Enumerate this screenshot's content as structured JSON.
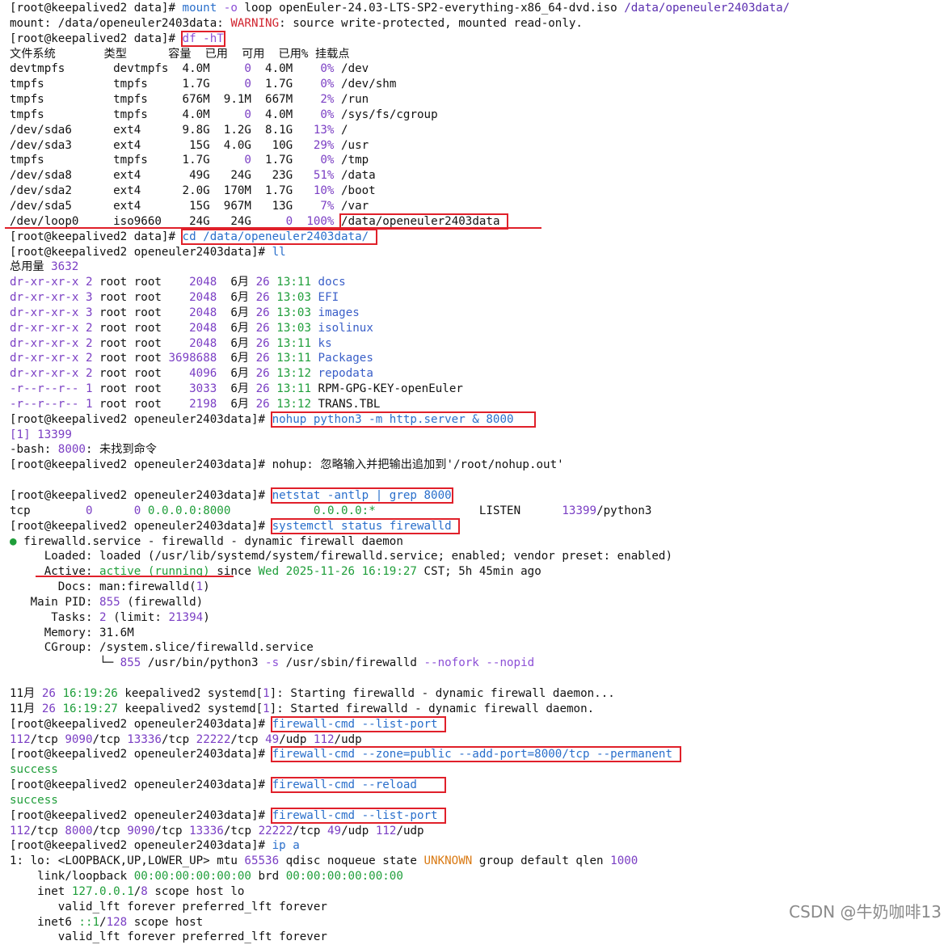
{
  "colors": {
    "prompt": "#111111",
    "cmd": "#2a6fcb",
    "flag": "#8c4fd6",
    "path": "#5b2fb0",
    "num": "#7b3fc4",
    "green": "#1f9e3a",
    "orange": "#d97a14",
    "red": "#d1242f",
    "dir": "#3a5fc8",
    "highlight": "#e0202a"
  },
  "watermark": "CSDN @牛奶咖啡13",
  "lines": [
    [
      [
        "[root@keepalived2 data]# ",
        "prompt"
      ],
      [
        "mount ",
        "cmd"
      ],
      [
        "-o ",
        "flag"
      ],
      [
        "loop openEuler-24.03-LTS-SP2-everything-x86_64-dvd.iso ",
        ""
      ],
      [
        "/data/openeuler2403data/",
        "path"
      ]
    ],
    [
      [
        "mount",
        ""
      ],
      [
        ": /data/openeuler2403data: ",
        ""
      ],
      [
        "WARNING",
        ""
      ],
      [
        ": source write-protected, mounted read-only.",
        ""
      ]
    ],
    [
      [
        "[root@keepalived2 data]# ",
        "prompt"
      ],
      [
        "df -hT",
        "flag",
        1
      ]
    ],
    [
      [
        "文件系统       类型      容量  已用  可用  已用% 挂载点",
        ""
      ]
    ],
    [
      [
        "devtmpfs       devtmpfs  4.0M     ",
        ""
      ],
      [
        "0",
        "num"
      ],
      [
        "  4.0M    ",
        ""
      ],
      [
        "0%",
        "num"
      ],
      [
        " /dev",
        ""
      ]
    ],
    [
      [
        "tmpfs          tmpfs     1.7G     ",
        ""
      ],
      [
        "0",
        "num"
      ],
      [
        "  1.7G    ",
        ""
      ],
      [
        "0%",
        "num"
      ],
      [
        " /dev/shm",
        ""
      ]
    ],
    [
      [
        "tmpfs          tmpfs     676M  9.1M  667M    ",
        ""
      ],
      [
        "2%",
        "num"
      ],
      [
        " /run",
        ""
      ]
    ],
    [
      [
        "tmpfs          tmpfs     4.0M     ",
        ""
      ],
      [
        "0",
        "num"
      ],
      [
        "  4.0M    ",
        ""
      ],
      [
        "0%",
        "num"
      ],
      [
        " /sys/fs/cgroup",
        ""
      ]
    ],
    [
      [
        "/dev/sda6      ext4      9.8G  1.2G  8.1G   ",
        ""
      ],
      [
        "13%",
        "num"
      ],
      [
        " /",
        ""
      ]
    ],
    [
      [
        "/dev/sda3      ext4       15G  4.0G   10G   ",
        ""
      ],
      [
        "29%",
        "num"
      ],
      [
        " /usr",
        ""
      ]
    ],
    [
      [
        "tmpfs          tmpfs     1.7G     ",
        ""
      ],
      [
        "0",
        "num"
      ],
      [
        "  1.7G    ",
        ""
      ],
      [
        "0%",
        "num"
      ],
      [
        " /tmp",
        ""
      ]
    ],
    [
      [
        "/dev/sda8      ext4       49G   24G   23G   ",
        ""
      ],
      [
        "51%",
        "num"
      ],
      [
        " /data",
        ""
      ]
    ],
    [
      [
        "/dev/sda2      ext4      2.0G  170M  1.7G   ",
        ""
      ],
      [
        "10%",
        "num"
      ],
      [
        " /boot",
        ""
      ]
    ],
    [
      [
        "/dev/sda5      ext4       15G  967M   13G    ",
        ""
      ],
      [
        "7%",
        "num"
      ],
      [
        " /var",
        ""
      ]
    ],
    [
      [
        "/dev/loop0     iso9660    24G   24G     ",
        ""
      ],
      [
        "0",
        "num"
      ],
      [
        "  ",
        ""
      ],
      [
        "100%",
        "num"
      ],
      [
        " ",
        ""
      ],
      [
        "/data/openeuler2403data ",
        "",
        1
      ]
    ],
    [
      [
        "[root@keepalived2 data]# ",
        "prompt"
      ],
      [
        "cd /data/openeuler2403data/ ",
        "cmd",
        1
      ]
    ],
    [
      [
        "[root@keepalived2 openeuler2403data]# ",
        "prompt"
      ],
      [
        "ll",
        "cmd"
      ]
    ],
    [
      [
        "总用量 ",
        ""
      ],
      [
        "3632",
        "num"
      ]
    ],
    [
      [
        "dr-xr-xr-x",
        "num"
      ],
      [
        " ",
        ""
      ],
      [
        "2",
        "num"
      ],
      [
        " root root    ",
        ""
      ],
      [
        "2048",
        "num"
      ],
      [
        "  6月 ",
        ""
      ],
      [
        "26",
        "num"
      ],
      [
        " ",
        ""
      ],
      [
        "13:11",
        "green"
      ],
      [
        " ",
        ""
      ],
      [
        "docs",
        "dir"
      ]
    ],
    [
      [
        "dr-xr-xr-x",
        "num"
      ],
      [
        " ",
        ""
      ],
      [
        "3",
        "num"
      ],
      [
        " root root    ",
        ""
      ],
      [
        "2048",
        "num"
      ],
      [
        "  6月 ",
        ""
      ],
      [
        "26",
        "num"
      ],
      [
        " ",
        ""
      ],
      [
        "13:03",
        "green"
      ],
      [
        " ",
        ""
      ],
      [
        "EFI",
        "dir"
      ]
    ],
    [
      [
        "dr-xr-xr-x",
        "num"
      ],
      [
        " ",
        ""
      ],
      [
        "3",
        "num"
      ],
      [
        " root root    ",
        ""
      ],
      [
        "2048",
        "num"
      ],
      [
        "  6月 ",
        ""
      ],
      [
        "26",
        "num"
      ],
      [
        " ",
        ""
      ],
      [
        "13:03",
        "green"
      ],
      [
        " ",
        ""
      ],
      [
        "images",
        "dir"
      ]
    ],
    [
      [
        "dr-xr-xr-x",
        "num"
      ],
      [
        " ",
        ""
      ],
      [
        "2",
        "num"
      ],
      [
        " root root    ",
        ""
      ],
      [
        "2048",
        "num"
      ],
      [
        "  6月 ",
        ""
      ],
      [
        "26",
        "num"
      ],
      [
        " ",
        ""
      ],
      [
        "13:03",
        "green"
      ],
      [
        " ",
        ""
      ],
      [
        "isolinux",
        "dir"
      ]
    ],
    [
      [
        "dr-xr-xr-x",
        "num"
      ],
      [
        " ",
        ""
      ],
      [
        "2",
        "num"
      ],
      [
        " root root    ",
        ""
      ],
      [
        "2048",
        "num"
      ],
      [
        "  6月 ",
        ""
      ],
      [
        "26",
        "num"
      ],
      [
        " ",
        ""
      ],
      [
        "13:11",
        "green"
      ],
      [
        " ",
        ""
      ],
      [
        "ks",
        "dir"
      ]
    ],
    [
      [
        "dr-xr-xr-x",
        "num"
      ],
      [
        " ",
        ""
      ],
      [
        "2",
        "num"
      ],
      [
        " root root ",
        ""
      ],
      [
        "3698688",
        "num"
      ],
      [
        "  6月 ",
        ""
      ],
      [
        "26",
        "num"
      ],
      [
        " ",
        ""
      ],
      [
        "13:11",
        "green"
      ],
      [
        " ",
        ""
      ],
      [
        "Packages",
        "dir"
      ]
    ],
    [
      [
        "dr-xr-xr-x",
        "num"
      ],
      [
        " ",
        ""
      ],
      [
        "2",
        "num"
      ],
      [
        " root root    ",
        ""
      ],
      [
        "4096",
        "num"
      ],
      [
        "  6月 ",
        ""
      ],
      [
        "26",
        "num"
      ],
      [
        " ",
        ""
      ],
      [
        "13:12",
        "green"
      ],
      [
        " ",
        ""
      ],
      [
        "repodata",
        "dir"
      ]
    ],
    [
      [
        "-r--r--r--",
        "num"
      ],
      [
        " ",
        ""
      ],
      [
        "1",
        "num"
      ],
      [
        " root root    ",
        ""
      ],
      [
        "3033",
        "num"
      ],
      [
        "  6月 ",
        ""
      ],
      [
        "26",
        "num"
      ],
      [
        " ",
        ""
      ],
      [
        "13:11",
        "green"
      ],
      [
        " RPM-GPG-KEY-openEuler",
        ""
      ]
    ],
    [
      [
        "-r--r--r--",
        "num"
      ],
      [
        " ",
        ""
      ],
      [
        "1",
        "num"
      ],
      [
        " root root    ",
        ""
      ],
      [
        "2198",
        "num"
      ],
      [
        "  6月 ",
        ""
      ],
      [
        "26",
        "num"
      ],
      [
        " ",
        ""
      ],
      [
        "13:12",
        "green"
      ],
      [
        " TRANS.TBL",
        ""
      ]
    ],
    [
      [
        "[root@keepalived2 openeuler2403data]# ",
        "prompt"
      ],
      [
        "nohup python3 -m http.server & 8000   ",
        "cmd",
        1
      ]
    ],
    [
      [
        "[1] 13399",
        "num"
      ]
    ],
    [
      [
        "-bash: ",
        ""
      ],
      [
        "8000",
        "num"
      ],
      [
        ": 未找到命令",
        ""
      ]
    ],
    [
      [
        "[root@keepalived2 openeuler2403data]# ",
        "prompt"
      ],
      [
        "nohup: 忽略输入并把输出追加到'/root/nohup.out'",
        ""
      ]
    ],
    [
      [
        "",
        ""
      ]
    ],
    [
      [
        "[root@keepalived2 openeuler2403data]# ",
        "prompt"
      ],
      [
        "netstat -antlp | grep 8000",
        "cmd",
        1
      ]
    ],
    [
      [
        "tcp        ",
        ""
      ],
      [
        "0",
        "num"
      ],
      [
        "      ",
        ""
      ],
      [
        "0",
        "num"
      ],
      [
        " ",
        ""
      ],
      [
        "0.0.0.0:8000",
        "green"
      ],
      [
        "            ",
        ""
      ],
      [
        "0.0.0.0:*",
        "green"
      ],
      [
        "               LISTEN      ",
        ""
      ],
      [
        "13399",
        "num"
      ],
      [
        "/python3",
        ""
      ]
    ],
    [
      [
        "[root@keepalived2 openeuler2403data]# ",
        "prompt"
      ],
      [
        "systemctl status firewalld ",
        "cmd",
        1
      ]
    ],
    [
      [
        "● ",
        "green"
      ],
      [
        "firewalld.service - firewalld - dynamic firewall daemon",
        ""
      ]
    ],
    [
      [
        "     Loaded: loaded (/usr/lib/systemd/system/firewalld.service; enabled; vendor preset: enabled)",
        ""
      ]
    ],
    [
      [
        "     Active: ",
        ""
      ],
      [
        "active (running)",
        "green"
      ],
      [
        " since ",
        ""
      ],
      [
        "Wed 2025-11-26 16:19:27",
        "green"
      ],
      [
        " CST; 5h 45min ago",
        ""
      ]
    ],
    [
      [
        "       Docs: man:firewalld(",
        ""
      ],
      [
        "1",
        "num"
      ],
      [
        ")",
        ""
      ]
    ],
    [
      [
        "   Main PID: ",
        ""
      ],
      [
        "855",
        "num"
      ],
      [
        " (firewalld)",
        ""
      ]
    ],
    [
      [
        "      Tasks: ",
        ""
      ],
      [
        "2",
        "num"
      ],
      [
        " (limit: ",
        ""
      ],
      [
        "21394",
        "num"
      ],
      [
        ")",
        ""
      ]
    ],
    [
      [
        "     Memory: 31.6M",
        ""
      ]
    ],
    [
      [
        "     CGroup: /system.slice/firewalld.service",
        ""
      ]
    ],
    [
      [
        "             └─ ",
        ""
      ],
      [
        "855",
        "num"
      ],
      [
        " /usr/bin/python3 ",
        ""
      ],
      [
        "-s",
        "flag"
      ],
      [
        " /usr/sbin/firewalld ",
        ""
      ],
      [
        "--nofork --nopid",
        "flag"
      ]
    ],
    [
      [
        "",
        ""
      ]
    ],
    [
      [
        "11月 ",
        ""
      ],
      [
        "26",
        "num"
      ],
      [
        " ",
        ""
      ],
      [
        "16:19:26",
        "green"
      ],
      [
        " keepalived2 systemd[",
        ""
      ],
      [
        "1",
        "num"
      ],
      [
        "]: Starting firewalld - dynamic firewall daemon...",
        ""
      ]
    ],
    [
      [
        "11月 ",
        ""
      ],
      [
        "26",
        "num"
      ],
      [
        " ",
        ""
      ],
      [
        "16:19:27",
        "green"
      ],
      [
        " keepalived2 systemd[",
        ""
      ],
      [
        "1",
        "num"
      ],
      [
        "]: Started firewalld - dynamic firewall daemon.",
        ""
      ]
    ],
    [
      [
        "[root@keepalived2 openeuler2403data]# ",
        "prompt"
      ],
      [
        "firewall-cmd --list-port ",
        "cmd",
        1
      ]
    ],
    [
      [
        "112",
        "num"
      ],
      [
        "/tcp ",
        ""
      ],
      [
        "9090",
        "num"
      ],
      [
        "/tcp ",
        ""
      ],
      [
        "13336",
        "num"
      ],
      [
        "/tcp ",
        ""
      ],
      [
        "22222",
        "num"
      ],
      [
        "/tcp ",
        ""
      ],
      [
        "49",
        "num"
      ],
      [
        "/udp ",
        ""
      ],
      [
        "112",
        "num"
      ],
      [
        "/udp",
        ""
      ]
    ],
    [
      [
        "[root@keepalived2 openeuler2403data]# ",
        "prompt"
      ],
      [
        "firewall-cmd --zone=public --add-port=8000/tcp --permanent ",
        "cmd",
        1
      ]
    ],
    [
      [
        "success",
        "green"
      ]
    ],
    [
      [
        "[root@keepalived2 openeuler2403data]# ",
        "prompt"
      ],
      [
        "firewall-cmd --reload    ",
        "cmd",
        1
      ]
    ],
    [
      [
        "success",
        "green"
      ]
    ],
    [
      [
        "[root@keepalived2 openeuler2403data]# ",
        "prompt"
      ],
      [
        "firewall-cmd --list-port ",
        "cmd",
        1
      ]
    ],
    [
      [
        "112",
        "num"
      ],
      [
        "/tcp ",
        ""
      ],
      [
        "8000",
        "num"
      ],
      [
        "/tcp ",
        ""
      ],
      [
        "9090",
        "num"
      ],
      [
        "/tcp ",
        ""
      ],
      [
        "13336",
        "num"
      ],
      [
        "/tcp ",
        ""
      ],
      [
        "22222",
        "num"
      ],
      [
        "/tcp ",
        ""
      ],
      [
        "49",
        "num"
      ],
      [
        "/udp ",
        ""
      ],
      [
        "112",
        "num"
      ],
      [
        "/udp",
        ""
      ]
    ],
    [
      [
        "[root@keepalived2 openeuler2403data]# ",
        "prompt"
      ],
      [
        "ip a",
        "cmd"
      ]
    ],
    [
      [
        "1",
        ""
      ],
      [
        ": lo: <LOOPBACK,UP,LOWER_UP> mtu ",
        ""
      ],
      [
        "65536",
        "num"
      ],
      [
        " qdisc noqueue state ",
        ""
      ],
      [
        "UNKNOWN",
        "orange"
      ],
      [
        " group default qlen ",
        ""
      ],
      [
        "1000",
        "num"
      ]
    ],
    [
      [
        "    link/loopback ",
        ""
      ],
      [
        "00:00:00:00:00:00",
        "green"
      ],
      [
        " brd ",
        ""
      ],
      [
        "00:00:00:00:00:00",
        "green"
      ]
    ],
    [
      [
        "    inet ",
        ""
      ],
      [
        "127.0.0.1",
        "green"
      ],
      [
        "/",
        ""
      ],
      [
        "8",
        "num"
      ],
      [
        " scope host lo",
        ""
      ]
    ],
    [
      [
        "       valid_lft forever preferred_lft forever",
        ""
      ]
    ],
    [
      [
        "    inet6 ",
        ""
      ],
      [
        "::1",
        "green"
      ],
      [
        "/",
        ""
      ],
      [
        "128",
        "num"
      ],
      [
        " scope host",
        ""
      ]
    ],
    [
      [
        "       valid_lft forever preferred_lft forever",
        ""
      ]
    ]
  ]
}
